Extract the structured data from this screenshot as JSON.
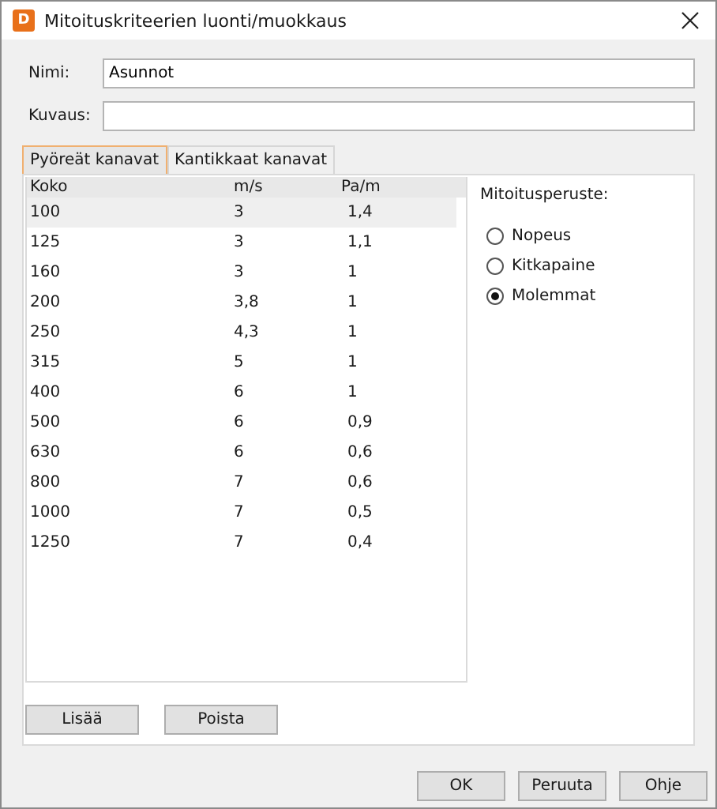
{
  "window": {
    "title": "Mitoituskriteerien luonti/muokkaus",
    "app_icon_letter": "D"
  },
  "fields": [
    {
      "label": "Nimi:",
      "value": "Asunnot"
    },
    {
      "label": "Kuvaus:"
    }
  ],
  "tabs": [
    {
      "label": "Pyöreät kanavat",
      "selected": true
    },
    {
      "label": "Kantikkaat kanavat",
      "selected": false
    }
  ],
  "table": {
    "columns": [
      "Koko",
      "m/s",
      "Pa/m"
    ],
    "rows": [
      {
        "cells": [
          "100",
          "3",
          "1,4"
        ],
        "selected": true
      },
      {
        "cells": [
          "125",
          "3",
          "1,1"
        ],
        "selected": false
      },
      {
        "cells": [
          "160",
          "3",
          "1"
        ],
        "selected": false
      },
      {
        "cells": [
          "200",
          "3,8",
          "1"
        ],
        "selected": false
      },
      {
        "cells": [
          "250",
          "4,3",
          "1"
        ],
        "selected": false
      },
      {
        "cells": [
          "315",
          "5",
          "1"
        ],
        "selected": false
      },
      {
        "cells": [
          "400",
          "6",
          "1"
        ],
        "selected": false
      },
      {
        "cells": [
          "500",
          "6",
          "0,9"
        ],
        "selected": false
      },
      {
        "cells": [
          "630",
          "6",
          "0,6"
        ],
        "selected": false
      },
      {
        "cells": [
          "800",
          "7",
          "0,6"
        ],
        "selected": false
      },
      {
        "cells": [
          "1000",
          "7",
          "0,5"
        ],
        "selected": false
      },
      {
        "cells": [
          "1250",
          "7",
          "0,4"
        ],
        "selected": false
      }
    ]
  },
  "basis": {
    "label": "Mitoitusperuste:",
    "options": [
      {
        "label": "Nopeus",
        "selected": false
      },
      {
        "label": "Kitkapaine",
        "selected": false
      },
      {
        "label": "Molemmat",
        "selected": true
      }
    ]
  },
  "table_buttons": [
    "Lisää",
    "Poista"
  ],
  "dialog_buttons": [
    "OK",
    "Peruuta",
    "Ohje"
  ]
}
